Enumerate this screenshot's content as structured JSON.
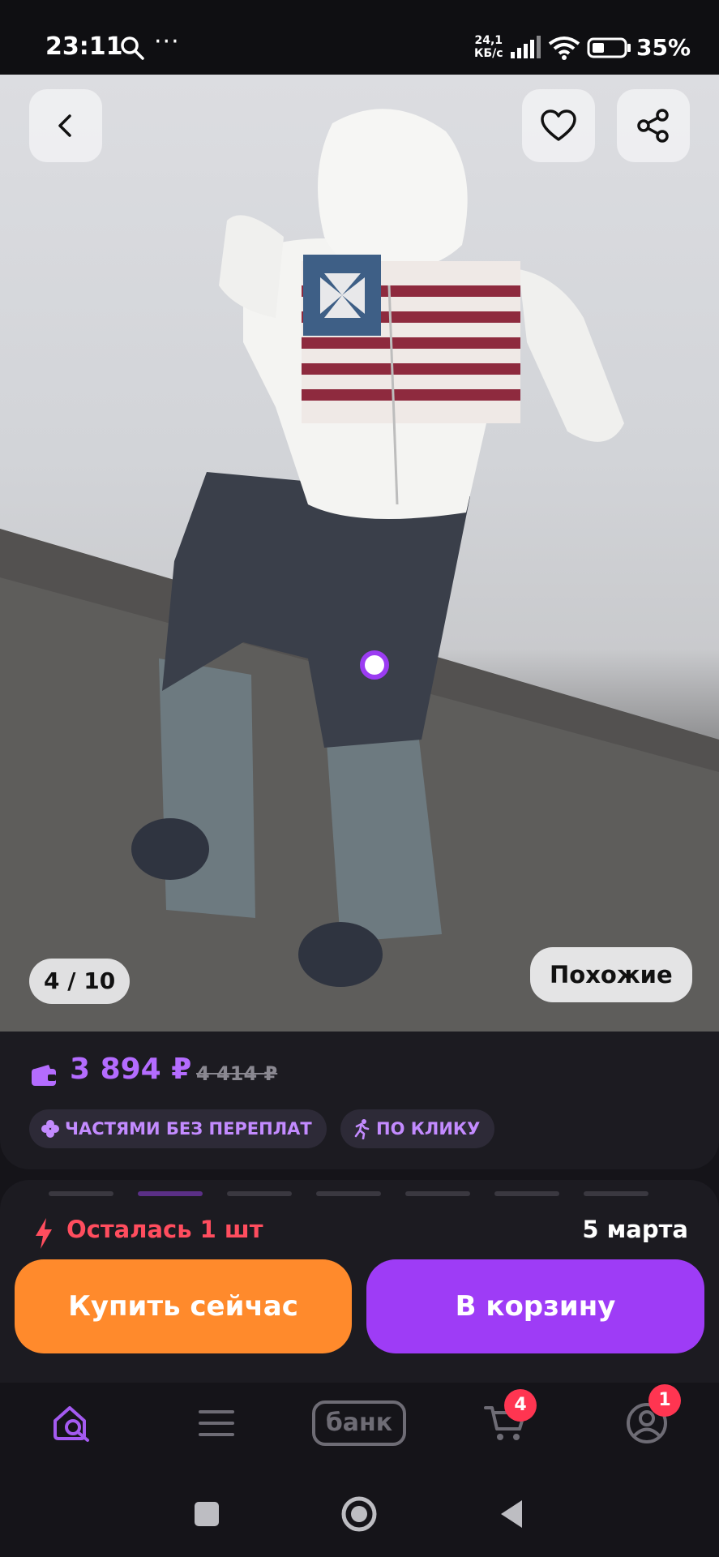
{
  "status_bar": {
    "time": "23:11",
    "net_speed_value": "24,1",
    "net_speed_unit": "КБ/с",
    "battery": "35%",
    "icons": [
      "search-icon",
      "more-dots-icon",
      "signal-icon",
      "wifi-icon",
      "battery-icon"
    ]
  },
  "gallery": {
    "counter": "4 / 10",
    "similar_label": "Похожие",
    "current_index": 4,
    "total": 10
  },
  "price": {
    "current": "3 894 ₽",
    "old": "4 414 ₽",
    "accent_color": "#b46cff"
  },
  "chips": {
    "installment": "ЧАСТЯМИ БЕЗ ПЕРЕПЛАТ",
    "one_click": "ПО КЛИКУ"
  },
  "purchase": {
    "stock_text": "Осталась 1 шт",
    "delivery_date": "5 марта",
    "buy_now": "Купить сейчас",
    "add_to_cart": "В корзину",
    "buy_color": "#ff8a2c",
    "cart_color": "#9e3cf6",
    "stock_color": "#ff4d5e"
  },
  "bottom_nav": {
    "bank_label": "банк",
    "cart_badge": "4",
    "profile_badge": "1",
    "icons": [
      "home-search-icon",
      "menu-icon",
      "cart-icon",
      "profile-icon"
    ]
  }
}
